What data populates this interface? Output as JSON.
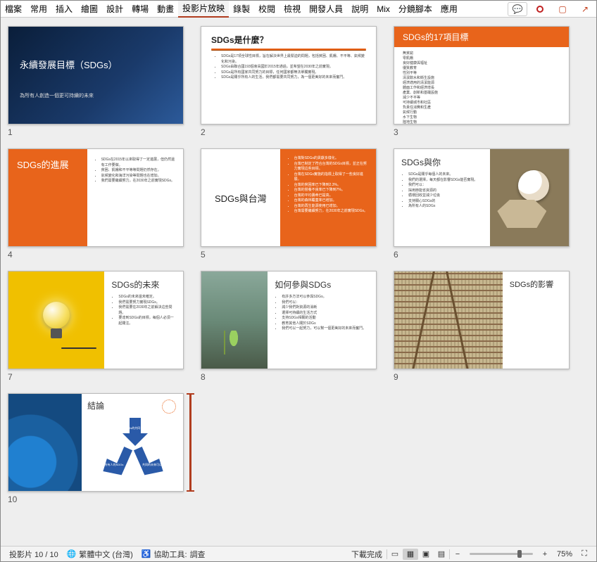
{
  "ribbon": {
    "tabs": [
      "檔案",
      "常用",
      "插入",
      "繪圖",
      "設計",
      "轉場",
      "動畫",
      "投影片放映",
      "錄製",
      "校閱",
      "檢視",
      "開發人員",
      "說明",
      "Mix",
      "分鏡腳本",
      "應用"
    ],
    "active": "投影片放映"
  },
  "slides": [
    {
      "n": "1",
      "title": "永續發展目標（SDGs）",
      "subtitle": "為所有人創造一個更可持續的未來"
    },
    {
      "n": "2",
      "title": "SDGs是什麼？",
      "bullets": [
        "SDGs是17項全球性目標，旨在解決世界上最緊迫的問題，包括貧困、飢餓、不平等、氣候變化和污染。",
        "SDGs由聯合國193個會員國於2015年通過，並希望在2030年之前實現。",
        "SDGs是所有國家共同努力的目標，任何國家都無法單獨實現。",
        "SDGs是關乎所有人的生活，我們都需要共同努力，為一個更美好的未來而奮鬥。"
      ]
    },
    {
      "n": "3",
      "title": "SDGs的17項目標",
      "body": "無貧窮\n零飢餓\n良好健康與福祉\n優質教育\n性別平等\n清潔飲水和衛生設施\n經濟適用的清潔能源\n體面工作和經濟增長\n產業、創新和基礎設施\n減少不平等\n可持續城市和社區\n負責任消費和生產\n氣候行動\n水下生物\n陸地生物\n和平、正義與強大機構\n促進目標實現的夥伴關係"
    },
    {
      "n": "4",
      "title": "SDGs的進展",
      "bullets": [
        "SDGs在2015年以來取得了一定進展，但仍然還有工作要做。",
        "貧困、飢餓和不平等等問題仍然存在。",
        "氣候變化和海洋污染等問題也在增加。",
        "我們需要繼續努力，在2030年之前實現SDGs。"
      ]
    },
    {
      "n": "5",
      "title": "SDGs與台灣",
      "bullets": [
        "台灣對SDGs的貢獻多樣化。",
        "台灣已制定了符合台灣的SDGs目標，並正在努力實現這些目標。",
        "台灣在SDGs實施的指標上取得了一些良好進展。",
        "台灣的貧困率已下降到2.3%。",
        "台灣的營養不良率已下降到7%。",
        "台灣的平均壽命已提高。",
        "台灣的森林覆蓋率已增加。",
        "台灣的再生能源使用已增加。",
        "台灣需要繼續努力，在2030年之前實現SDGs。"
      ]
    },
    {
      "n": "6",
      "title": "SDGs與你",
      "bullets": [
        "SDGs是關乎每個人的未來。",
        "我們的選擇，每天都在影響SDGs能否實現。",
        "我們可以：",
        "採用節能省資源的",
        "循環回收並減少垃圾",
        "支持關心SDGs的",
        "為所有人的SDGs"
      ]
    },
    {
      "n": "7",
      "title": "SDGs的未來",
      "bullets": [
        "SDGs的未來還未確定。",
        "我們需要努力實現SDGs。",
        "我們需要在2030年之前解決這些問題。",
        "要達到SDGs的目標，每個人必須一起關注。"
      ]
    },
    {
      "n": "8",
      "title": "如何參與SDGs",
      "bullets": [
        "有許多方法可以參與SDGs。",
        "我們可以：",
        "減少我們對資源的消耗",
        "選擇可持續的生活方式",
        "支持SDGs相關的活動",
        "教育其他人關於SDGs",
        "我們可以一起努力，可以幫一個更美好的未來而奮鬥。"
      ]
    },
    {
      "n": "9",
      "title": "SDGs的影響",
      "bullets": []
    },
    {
      "n": "10",
      "title": "結論",
      "arrows": [
        "SDGs的共同目標",
        "為所有人的SDGs",
        "共同的未來可以改變"
      ]
    }
  ],
  "status": {
    "slide": "投影片 10 / 10",
    "lang": "繁體中文 (台灣)",
    "a11y_label": "協助工具:",
    "a11y_val": "調查",
    "download": "下載完成",
    "zoom": "75%"
  }
}
